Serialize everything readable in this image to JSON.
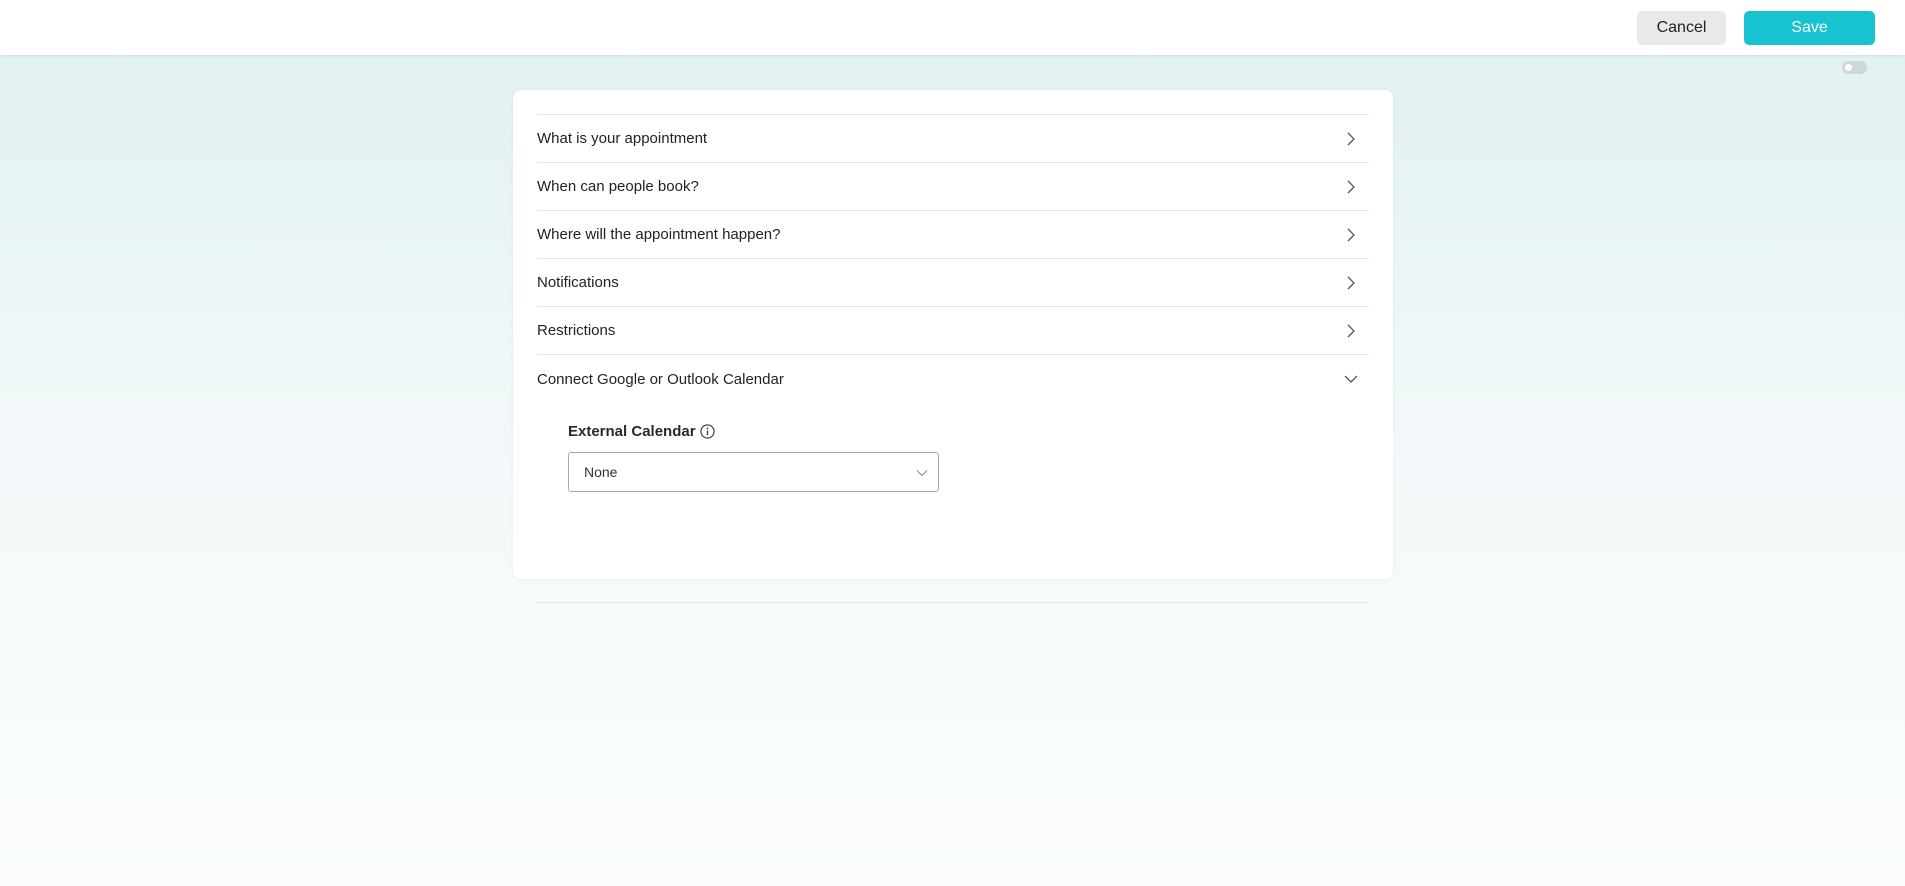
{
  "header": {
    "cancel_label": "Cancel",
    "save_label": "Save",
    "accent_color": "#17c3d0"
  },
  "accordion": {
    "items": [
      {
        "label": "What is your appointment",
        "state": "collapsed",
        "icon": "chevron-right-icon"
      },
      {
        "label": "When can people book?",
        "state": "collapsed",
        "icon": "chevron-right-icon"
      },
      {
        "label": "Where will the appointment happen?",
        "state": "collapsed",
        "icon": "chevron-right-icon"
      },
      {
        "label": "Notifications",
        "state": "collapsed",
        "icon": "chevron-right-icon"
      },
      {
        "label": "Restrictions",
        "state": "collapsed",
        "icon": "chevron-right-icon"
      },
      {
        "label": "Connect Google or Outlook Calendar",
        "state": "expanded",
        "icon": "chevron-down-icon"
      }
    ]
  },
  "calendar_panel": {
    "field_label": "External Calendar",
    "info_icon": "info-icon",
    "select_value": "None"
  },
  "toggle": {
    "state": "off"
  }
}
